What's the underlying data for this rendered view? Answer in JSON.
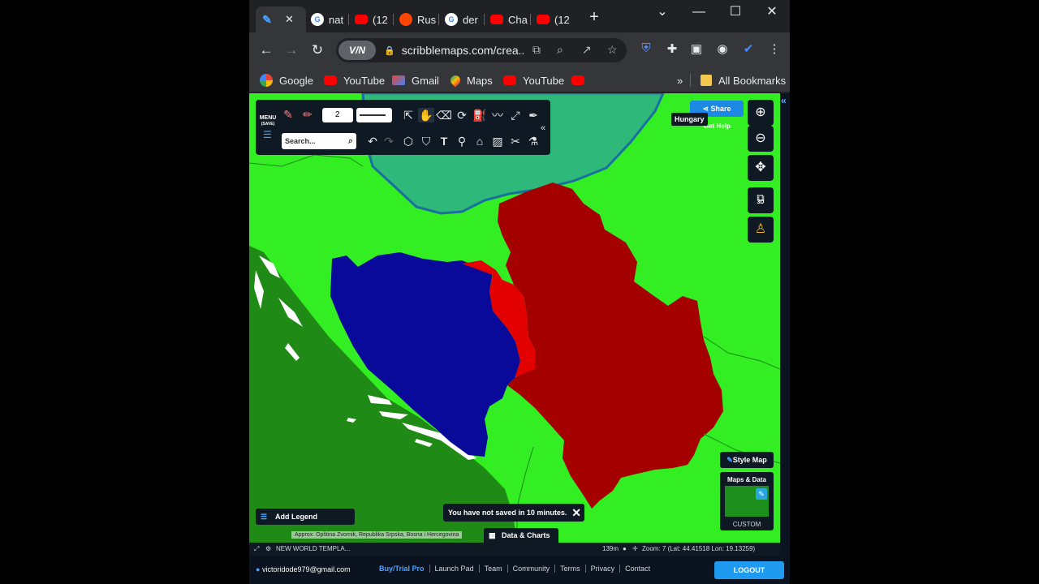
{
  "tabs": [
    {
      "label": "",
      "icon": "scribblemaps-icon",
      "active": true
    },
    {
      "label": "nat",
      "icon": "google-icon"
    },
    {
      "label": "(12",
      "icon": "youtube-icon"
    },
    {
      "label": "Rus",
      "icon": "reddit-icon"
    },
    {
      "label": "der",
      "icon": "google-icon"
    },
    {
      "label": "Cha",
      "icon": "youtube-icon"
    },
    {
      "label": "(12",
      "icon": "youtube-icon"
    }
  ],
  "toolbar": {
    "url": "scribblemaps.com/crea...",
    "vpn_label": "V/N"
  },
  "bookmarks": [
    {
      "label": "Google",
      "icon": "google-icon"
    },
    {
      "label": "YouTube",
      "icon": "youtube-icon"
    },
    {
      "label": "Gmail",
      "icon": "gmail-icon"
    },
    {
      "label": "Maps",
      "icon": "maps-icon"
    },
    {
      "label": "YouTube",
      "icon": "youtube-icon"
    },
    {
      "label": "",
      "icon": "youtube-icon"
    }
  ],
  "bookmarks_all": "All Bookmarks",
  "tool_panel": {
    "menu_label": "MENU",
    "menu_sub": "(SAVE)",
    "line_width": "2",
    "search_placeholder": "Search..."
  },
  "map_controls": {
    "share_label": "Share",
    "help_label": "Get Help",
    "tooltip": "Hungary",
    "three_d": "3D",
    "style_map": "Style Map",
    "maps_data": "Maps & Data",
    "custom": "CUSTOM",
    "add_legend": "Add Legend",
    "not_saved": "You have not saved in 10 minutes.",
    "approx": "Approx: Opština Zvornik, Republika Srpska, Bosna i Hercegovina",
    "data_charts": "Data & Charts"
  },
  "status_bar": {
    "template": "NEW WORLD TEMPLA...",
    "scale": "139m",
    "zoom_info": "Zoom: 7 (Lat: 44.41518 Lon: 19.13259)"
  },
  "footer": {
    "email": "victoridode979@gmail.com",
    "links": [
      "Buy/Trial Pro",
      "Launch Pad",
      "Team",
      "Community",
      "Terms",
      "Privacy",
      "Contact"
    ],
    "logout": "LOGOUT"
  },
  "colors": {
    "map_green": "#33ee22",
    "dark_green": "#208a16",
    "teal": "#2eb87a",
    "red": "#a50000",
    "bright_red": "#e30000",
    "blue": "#0a0a9a",
    "panel": "#0f1923"
  }
}
